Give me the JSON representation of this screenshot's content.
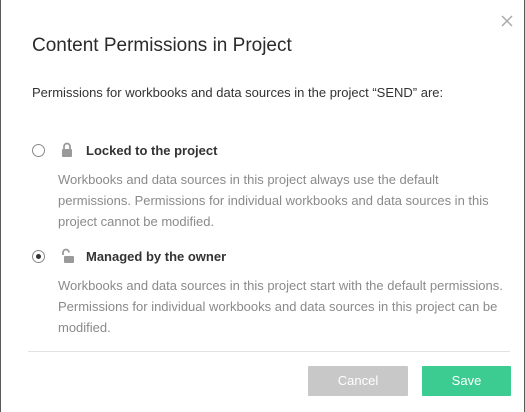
{
  "dialog": {
    "title": "Content Permissions in Project",
    "intro": "Permissions for workbooks and data sources in the project “SEND” are:",
    "options": [
      {
        "label": "Locked to the project",
        "description": "Workbooks and data sources in this project always use the default permissions. Permissions for individual workbooks and data sources in this project cannot be modified.",
        "selected": false,
        "icon": "lock-closed-icon"
      },
      {
        "label": "Managed by the owner",
        "description": "Workbooks and data sources in this project start with the default permissions. Permissions for individual workbooks and data sources in this project can be modified.",
        "selected": true,
        "icon": "lock-open-icon"
      }
    ],
    "buttons": {
      "cancel_label": "Cancel",
      "save_label": "Save"
    },
    "colors": {
      "save": "#3ccb90",
      "cancel": "#c8c8c8"
    },
    "close_icon": "close-icon"
  }
}
